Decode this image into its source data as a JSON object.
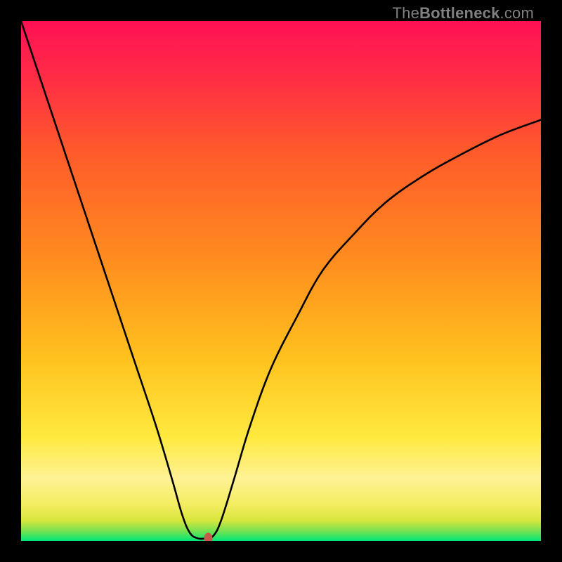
{
  "watermark": {
    "prefix": "The",
    "bold": "Bottleneck",
    "suffix": ".com"
  },
  "chart_data": {
    "type": "line",
    "title": "",
    "xlabel": "",
    "ylabel": "",
    "xlim": [
      0,
      100
    ],
    "ylim": [
      0,
      100
    ],
    "grid": false,
    "legend": false,
    "annotations": [],
    "gradient_stops": [
      {
        "pos": 0,
        "color": "#00e676"
      },
      {
        "pos": 0.02,
        "color": "#7be24f"
      },
      {
        "pos": 0.04,
        "color": "#d9e63d"
      },
      {
        "pos": 0.07,
        "color": "#f3ed60"
      },
      {
        "pos": 0.12,
        "color": "#fff295"
      },
      {
        "pos": 0.2,
        "color": "#ffe93f"
      },
      {
        "pos": 0.35,
        "color": "#ffc21e"
      },
      {
        "pos": 0.55,
        "color": "#ff8a1f"
      },
      {
        "pos": 0.75,
        "color": "#ff5a2b"
      },
      {
        "pos": 0.9,
        "color": "#ff2a47"
      },
      {
        "pos": 1.0,
        "color": "#ff1154"
      }
    ],
    "series": [
      {
        "name": "bottleneck-curve",
        "color": "#000000",
        "points": [
          {
            "x": 0,
            "y": 100
          },
          {
            "x": 3,
            "y": 91
          },
          {
            "x": 6,
            "y": 82
          },
          {
            "x": 10,
            "y": 70
          },
          {
            "x": 14,
            "y": 58
          },
          {
            "x": 18,
            "y": 46
          },
          {
            "x": 22,
            "y": 34
          },
          {
            "x": 26,
            "y": 22
          },
          {
            "x": 29,
            "y": 12
          },
          {
            "x": 31,
            "y": 5
          },
          {
            "x": 32.5,
            "y": 1.5
          },
          {
            "x": 34,
            "y": 0.5
          },
          {
            "x": 35.5,
            "y": 0.5
          },
          {
            "x": 37,
            "y": 1.0
          },
          {
            "x": 38.5,
            "y": 4
          },
          {
            "x": 41,
            "y": 12
          },
          {
            "x": 44,
            "y": 22
          },
          {
            "x": 48,
            "y": 33
          },
          {
            "x": 53,
            "y": 43
          },
          {
            "x": 58,
            "y": 52
          },
          {
            "x": 64,
            "y": 59
          },
          {
            "x": 70,
            "y": 65
          },
          {
            "x": 77,
            "y": 70
          },
          {
            "x": 84,
            "y": 74
          },
          {
            "x": 92,
            "y": 78
          },
          {
            "x": 100,
            "y": 81
          }
        ]
      }
    ],
    "marker": {
      "x": 36,
      "y": 0.5,
      "color": "#c65a4a"
    }
  }
}
